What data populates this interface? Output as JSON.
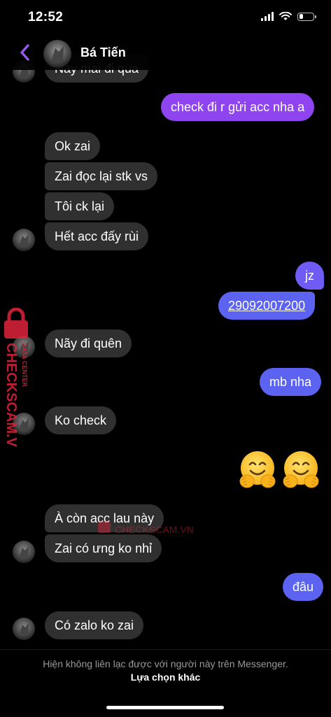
{
  "status_bar": {
    "time": "12:52",
    "signal_icon": "cellular-signal-icon",
    "wifi_icon": "wifi-icon",
    "battery_icon": "battery-icon",
    "battery_level": 0.25
  },
  "header": {
    "back_icon": "chevron-left-icon",
    "contact_name": "Bá Tiến"
  },
  "messages": [
    {
      "direction": "in",
      "text": "Này mai đi qua"
    },
    {
      "direction": "out",
      "text": "check đi r gửi acc nha a"
    },
    {
      "direction": "in",
      "text": "Ok zai"
    },
    {
      "direction": "in",
      "text": "Zai đọc lại stk vs"
    },
    {
      "direction": "in",
      "text": "Tôi ck lại"
    },
    {
      "direction": "in",
      "text": "Hết acc đấy rùi"
    },
    {
      "direction": "out",
      "text": "jz"
    },
    {
      "direction": "out",
      "text": "29092007200"
    },
    {
      "direction": "in",
      "text": "Nãy đi quên"
    },
    {
      "direction": "out",
      "text": "mb nha"
    },
    {
      "direction": "in",
      "text": "Ko check"
    },
    {
      "direction": "out",
      "emoji": "hugging-face-emoji"
    },
    {
      "direction": "out",
      "emoji": "hugging-face-emoji"
    },
    {
      "direction": "in",
      "text": "À còn acc lau này"
    },
    {
      "direction": "in",
      "text": "Zai có ưng ko nhỉ"
    },
    {
      "direction": "out",
      "text": "đâu"
    },
    {
      "direction": "in",
      "text": "Có zalo ko zai"
    }
  ],
  "watermark": {
    "brand": "CHECKSCAM.VN",
    "tagline": "DATA CENTER",
    "icon": "padlock-icon",
    "color": "#e0243a"
  },
  "bottom": {
    "notice": "Hiện không liên lạc được với người này trên Messenger.",
    "other_option": "Lựa chọn khác"
  },
  "colors": {
    "incoming_bubble": "#303030",
    "outgoing_purple": "#8e45f0",
    "outgoing_blue": "#5b63f0",
    "accent": "#9b5cf6"
  }
}
